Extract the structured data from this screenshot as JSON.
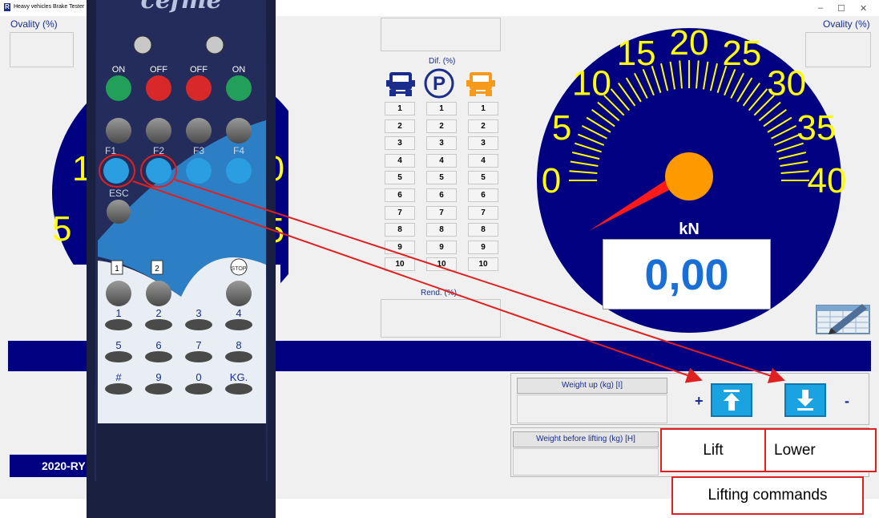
{
  "window": {
    "title": "Heavy vehicles Brake Tester",
    "controls": [
      "–",
      "☐",
      "✕"
    ]
  },
  "left_panel": {
    "ovality_label": "Ovality (%)",
    "dial_labels_visible": [
      "10",
      "5",
      "0"
    ]
  },
  "right_panel": {
    "ovality_label": "Ovality (%)"
  },
  "dial": {
    "ticks": [
      "0",
      "5",
      "10",
      "15",
      "20",
      "25",
      "30",
      "35",
      "40"
    ],
    "unit": "kN",
    "value": "0,00",
    "partial_ticks": [
      "30",
      "35",
      "40"
    ]
  },
  "dif_table": {
    "dif_label": "Dif. (%)",
    "rend_label": "Rend. (%)",
    "rows": [
      "1",
      "2",
      "3",
      "4",
      "5",
      "6",
      "7",
      "8",
      "9",
      "10"
    ]
  },
  "weight": {
    "weight_up_label": "Weight up (kg) [I]",
    "weight_before_label": "Weight before lifting (kg) [H]",
    "plus": "+",
    "minus": "-"
  },
  "footer": {
    "text": "2020-RY"
  },
  "callouts": {
    "lift": "Lift",
    "lower": "Lower",
    "lifting_commands": "Lifting commands"
  },
  "remote": {
    "brand": "cefme",
    "on_left": "ON",
    "off_left": "OFF",
    "off_right": "OFF",
    "on_right": "ON",
    "f_keys": [
      "F1",
      "F2",
      "F3",
      "F4"
    ],
    "esc": "ESC",
    "stop": "STOP",
    "num_keys": [
      "1",
      "2",
      "3",
      "4",
      "5",
      "6",
      "7",
      "8",
      "#",
      "9",
      "0",
      "KG."
    ],
    "doc1": "1",
    "doc2": "2"
  },
  "colors": {
    "navy": "#000080",
    "dial_tick": "#ffff00",
    "needle": "#ff1a1a",
    "hub": "#ff9900",
    "value_text": "#1a6fd6",
    "button_blue": "#1aa3e0",
    "callout_red": "#e02020"
  }
}
